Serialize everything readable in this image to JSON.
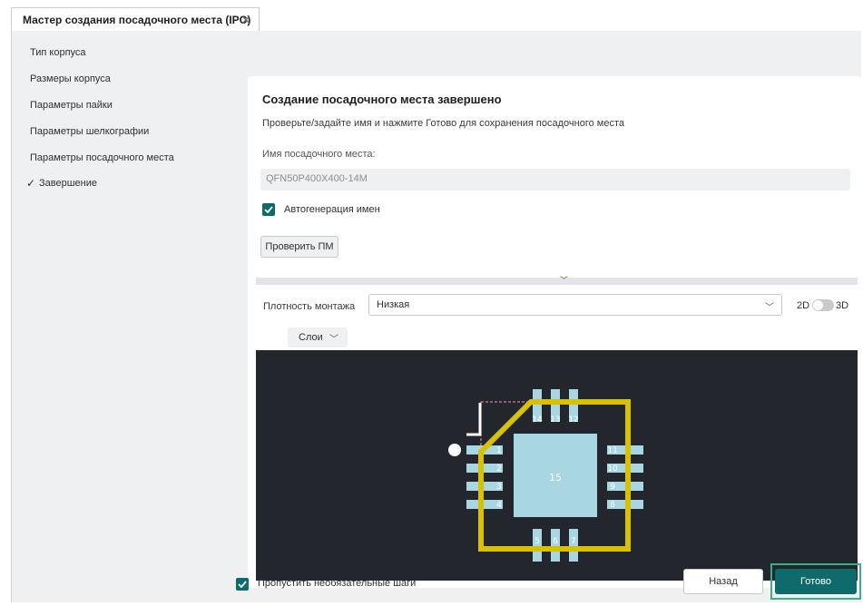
{
  "window": {
    "tab_title": "Мастер создания посадочного места (IPC)",
    "tab_close_icon": "close-icon"
  },
  "steps": [
    {
      "label": "Тип корпуса",
      "done": false
    },
    {
      "label": "Размеры корпуса",
      "done": false
    },
    {
      "label": "Параметры пайки",
      "done": false
    },
    {
      "label": "Параметры шелкографии",
      "done": false
    },
    {
      "label": "Параметры посадочного места",
      "done": false
    },
    {
      "label": "Завершение",
      "done": true,
      "current": true
    }
  ],
  "completion": {
    "title": "Создание посадочного места завершено",
    "subtitle": "Проверьте/задайте имя и нажмите Готово для сохранения посадочного места",
    "name_label": "Имя посадочного места:",
    "name_value": "QFN50P400X400-14M",
    "autogen_label": "Автогенерация имен",
    "autogen_checked": true,
    "check_button": "Проверить ПМ"
  },
  "preview": {
    "density_label": "Плотность монтажа",
    "density_value": "Низкая",
    "mode_2d": "2D",
    "mode_3d": "3D",
    "mode_3d_enabled": false,
    "layers_label": "Слои",
    "pads": {
      "left": [
        "1",
        "2",
        "3",
        "4"
      ],
      "bottom": [
        "5",
        "6",
        "7"
      ],
      "right": [
        "8",
        "9",
        "10",
        "11"
      ],
      "top": [
        "12",
        "13",
        "14"
      ],
      "center": "15"
    },
    "colors": {
      "canvas": "#23272d",
      "pad": "#a9d6e3",
      "courtyard": "#d7c100",
      "assembly": "#ff8fb1",
      "silk": "#ffffff"
    }
  },
  "footer": {
    "skip_label": "Пропустить необязательные шаги",
    "skip_checked": true,
    "back_button": "Назад",
    "done_button": "Готово"
  },
  "accent": "#0f6b6b"
}
